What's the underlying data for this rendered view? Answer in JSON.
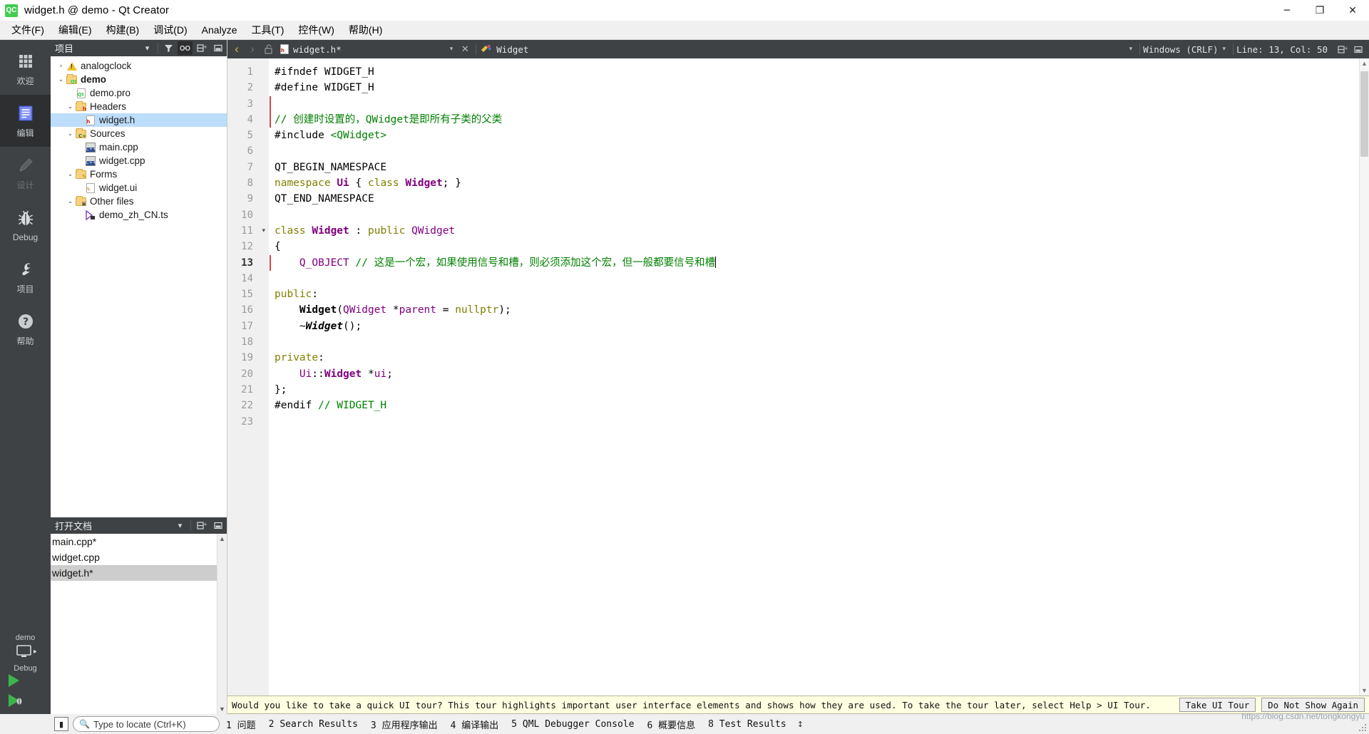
{
  "window": {
    "title": "widget.h @ demo - Qt Creator",
    "app_icon": "qt-creator-icon",
    "minimize_label": "─",
    "maximize_label": "❐",
    "close_label": "✕"
  },
  "menubar": {
    "items": [
      {
        "label": "文件(F)",
        "name": "menu-file"
      },
      {
        "label": "编辑(E)",
        "name": "menu-edit"
      },
      {
        "label": "构建(B)",
        "name": "menu-build"
      },
      {
        "label": "调试(D)",
        "name": "menu-debug"
      },
      {
        "label": "Analyze",
        "name": "menu-analyze"
      },
      {
        "label": "工具(T)",
        "name": "menu-tools"
      },
      {
        "label": "控件(W)",
        "name": "menu-window"
      },
      {
        "label": "帮助(H)",
        "name": "menu-help"
      }
    ]
  },
  "moderail": {
    "modes": [
      {
        "label": "欢迎",
        "icon": "grid-icon",
        "state": "normal"
      },
      {
        "label": "编辑",
        "icon": "document-lines-icon",
        "state": "active"
      },
      {
        "label": "设计",
        "icon": "pencil-icon",
        "state": "disabled"
      },
      {
        "label": "Debug",
        "icon": "bug-icon",
        "state": "normal"
      },
      {
        "label": "项目",
        "icon": "wrench-icon",
        "state": "normal"
      },
      {
        "label": "帮助",
        "icon": "question-circle-icon",
        "state": "normal"
      }
    ],
    "kit": {
      "project": "demo",
      "build_config": "Debug",
      "icon": "desktop-icon",
      "chevron": "▸"
    },
    "run_button": "run-icon",
    "debug_button": "run-debug-icon"
  },
  "project_dock": {
    "title": "项目",
    "buttons": [
      {
        "name": "dock-menu-button",
        "glyph": "▾"
      },
      {
        "name": "filter-icon",
        "glyph": "∇"
      },
      {
        "name": "link-with-editor-icon",
        "glyph": "⚭",
        "active": true
      },
      {
        "name": "split-icon",
        "glyph": "⬚⁺"
      },
      {
        "name": "close-dock-icon",
        "glyph": "▭"
      }
    ],
    "tree": [
      {
        "label": "analogclock",
        "indent": 0,
        "arrow": "›",
        "icon": "warning-icon",
        "bold": false,
        "selected": false
      },
      {
        "label": "demo",
        "indent": 0,
        "arrow": "⌄",
        "icon": "qt-folder-icon",
        "bold": true,
        "selected": false
      },
      {
        "label": "demo.pro",
        "indent": 1,
        "arrow": "",
        "icon": "qt-pro-file-icon",
        "bold": false,
        "selected": false
      },
      {
        "label": "Headers",
        "indent": 1,
        "arrow": "⌄",
        "icon": "headers-folder-icon",
        "bold": false,
        "selected": false
      },
      {
        "label": "widget.h",
        "indent": 2,
        "arrow": "",
        "icon": "header-file-icon",
        "bold": false,
        "selected": true
      },
      {
        "label": "Sources",
        "indent": 1,
        "arrow": "⌄",
        "icon": "sources-folder-icon",
        "bold": false,
        "selected": false
      },
      {
        "label": "main.cpp",
        "indent": 2,
        "arrow": "",
        "icon": "cpp-file-icon",
        "bold": false,
        "selected": false
      },
      {
        "label": "widget.cpp",
        "indent": 2,
        "arrow": "",
        "icon": "cpp-file-icon",
        "bold": false,
        "selected": false
      },
      {
        "label": "Forms",
        "indent": 1,
        "arrow": "⌄",
        "icon": "forms-folder-icon",
        "bold": false,
        "selected": false
      },
      {
        "label": "widget.ui",
        "indent": 2,
        "arrow": "",
        "icon": "ui-file-icon",
        "bold": false,
        "selected": false
      },
      {
        "label": "Other files",
        "indent": 1,
        "arrow": "⌄",
        "icon": "other-folder-icon",
        "bold": false,
        "selected": false
      },
      {
        "label": "demo_zh_CN.ts",
        "indent": 2,
        "arrow": "",
        "icon": "ts-file-icon",
        "bold": false,
        "selected": false
      }
    ]
  },
  "open_documents": {
    "title": "打开文档",
    "buttons": [
      {
        "name": "opendocs-menu-button",
        "glyph": "▾"
      },
      {
        "name": "split-icon",
        "glyph": "⬚⁺"
      },
      {
        "name": "close-dock-icon",
        "glyph": "▭"
      }
    ],
    "items": [
      {
        "label": "main.cpp*",
        "selected": false
      },
      {
        "label": "widget.cpp",
        "selected": false
      },
      {
        "label": "widget.h*",
        "selected": true
      }
    ],
    "scroll_up": "▲",
    "scroll_down": "▼"
  },
  "editor_toolbar": {
    "back_glyph": "‹",
    "forward_glyph": "›",
    "lock_icon": "unlocked-icon",
    "file_icon": "header-file-icon",
    "file_name": "widget.h*",
    "file_dropdown_glyph": "▾",
    "close_glyph": "✕",
    "symbol_icon": "class-symbol-icon",
    "symbol_name": "Widget",
    "symbol_dropdown_glyph": "▾",
    "line_ending": "Windows (CRLF)",
    "line_ending_glyph": "▾",
    "cursor_position": "Line: 13, Col: 50",
    "split_glyph": "⬚⁺",
    "close_split_glyph": "▭"
  },
  "editor": {
    "current_line": 13,
    "total_lines": 23,
    "modified_lines": [
      3,
      4,
      13
    ],
    "fold_markers": {
      "11": "▾"
    },
    "lines": [
      {
        "n": 1,
        "tokens": [
          {
            "t": "#ifndef WIDGET_H",
            "c": "k-pre"
          }
        ]
      },
      {
        "n": 2,
        "tokens": [
          {
            "t": "#define WIDGET_H",
            "c": "k-pre"
          }
        ]
      },
      {
        "n": 3,
        "tokens": []
      },
      {
        "n": 4,
        "tokens": [
          {
            "t": "// 创建时设置的，QWidget是即所有子类的父类",
            "c": "k-cmt"
          }
        ]
      },
      {
        "n": 5,
        "tokens": [
          {
            "t": "#include ",
            "c": "k-pre"
          },
          {
            "t": "<QWidget>",
            "c": "k-str"
          }
        ]
      },
      {
        "n": 6,
        "tokens": []
      },
      {
        "n": 7,
        "tokens": [
          {
            "t": "QT_BEGIN_NAMESPACE",
            "c": "k-plain"
          }
        ]
      },
      {
        "n": 8,
        "tokens": [
          {
            "t": "namespace ",
            "c": "k-kw"
          },
          {
            "t": "Ui",
            "c": "k-type"
          },
          {
            "t": " { ",
            "c": "k-op"
          },
          {
            "t": "class ",
            "c": "k-kw"
          },
          {
            "t": "Widget",
            "c": "k-type"
          },
          {
            "t": "; }",
            "c": "k-op"
          }
        ]
      },
      {
        "n": 9,
        "tokens": [
          {
            "t": "QT_END_NAMESPACE",
            "c": "k-plain"
          }
        ]
      },
      {
        "n": 10,
        "tokens": []
      },
      {
        "n": 11,
        "tokens": [
          {
            "t": "class ",
            "c": "k-kw"
          },
          {
            "t": "Widget",
            "c": "k-type"
          },
          {
            "t": " : ",
            "c": "k-op"
          },
          {
            "t": "public ",
            "c": "k-kw"
          },
          {
            "t": "QWidget",
            "c": "k-typep"
          }
        ]
      },
      {
        "n": 12,
        "tokens": [
          {
            "t": "{",
            "c": "k-op"
          }
        ]
      },
      {
        "n": 13,
        "tokens": [
          {
            "t": "    ",
            "c": "k-op"
          },
          {
            "t": "Q_OBJECT",
            "c": "k-typep"
          },
          {
            "t": " ",
            "c": "k-op"
          },
          {
            "t": "// 这是一个宏，如果使用信号和槽，则必须添加这个宏，但一般都要信号和槽",
            "c": "k-cmt"
          }
        ]
      },
      {
        "n": 14,
        "tokens": []
      },
      {
        "n": 15,
        "tokens": [
          {
            "t": "public",
            "c": "k-kw"
          },
          {
            "t": ":",
            "c": "k-op"
          }
        ]
      },
      {
        "n": 16,
        "tokens": [
          {
            "t": "    ",
            "c": "k-op"
          },
          {
            "t": "Widget",
            "c": "k-fn"
          },
          {
            "t": "(",
            "c": "k-op"
          },
          {
            "t": "QWidget",
            "c": "k-typep"
          },
          {
            "t": " *",
            "c": "k-op"
          },
          {
            "t": "parent",
            "c": "k-typep"
          },
          {
            "t": " = ",
            "c": "k-op"
          },
          {
            "t": "nullptr",
            "c": "k-kw"
          },
          {
            "t": ");",
            "c": "k-op"
          }
        ]
      },
      {
        "n": 17,
        "tokens": [
          {
            "t": "    ~",
            "c": "k-op"
          },
          {
            "t": "Widget",
            "c": "k-fni"
          },
          {
            "t": "();",
            "c": "k-op"
          }
        ]
      },
      {
        "n": 18,
        "tokens": []
      },
      {
        "n": 19,
        "tokens": [
          {
            "t": "private",
            "c": "k-kw"
          },
          {
            "t": ":",
            "c": "k-op"
          }
        ]
      },
      {
        "n": 20,
        "tokens": [
          {
            "t": "    ",
            "c": "k-op"
          },
          {
            "t": "Ui",
            "c": "k-typep"
          },
          {
            "t": "::",
            "c": "k-op"
          },
          {
            "t": "Widget",
            "c": "k-type"
          },
          {
            "t": " *",
            "c": "k-op"
          },
          {
            "t": "ui",
            "c": "k-typep"
          },
          {
            "t": ";",
            "c": "k-op"
          }
        ]
      },
      {
        "n": 21,
        "tokens": [
          {
            "t": "};",
            "c": "k-op"
          }
        ]
      },
      {
        "n": 22,
        "tokens": [
          {
            "t": "#endif ",
            "c": "k-pre"
          },
          {
            "t": "// WIDGET_H",
            "c": "k-cmt"
          }
        ]
      },
      {
        "n": 23,
        "tokens": []
      }
    ]
  },
  "infobar": {
    "message": "Would you like to take a quick UI tour? This tour highlights important user interface elements and shows how they are used. To take the tour later, select Help > UI Tour.",
    "primary_button": "Take UI Tour",
    "secondary_button": "Do Not Show Again"
  },
  "statusbar": {
    "toggle_sidebar_icon": "toggle-sidebar-icon",
    "locator": {
      "icon": "search-icon",
      "placeholder": "Type to locate (Ctrl+K)",
      "value": ""
    },
    "panes": [
      {
        "num": "1",
        "label": "问题"
      },
      {
        "num": "2",
        "label": "Search Results"
      },
      {
        "num": "3",
        "label": "应用程序输出"
      },
      {
        "num": "4",
        "label": "编译输出"
      },
      {
        "num": "5",
        "label": "QML Debugger Console"
      },
      {
        "num": "6",
        "label": "概要信息"
      },
      {
        "num": "8",
        "label": "Test Results"
      }
    ],
    "updown_glyph": "↕",
    "watermark": "https://blog.csdn.net/tongkongyu"
  },
  "colors": {
    "accent": "#41cd52",
    "dark_chrome": "#3f4244",
    "dark_chrome_active": "#2d2f31",
    "selection_blue": "#bdddfb",
    "infobar_bg": "#ffffe1",
    "comment_green": "#008000",
    "type_purple": "#800080",
    "keyword_olive": "#808000"
  }
}
